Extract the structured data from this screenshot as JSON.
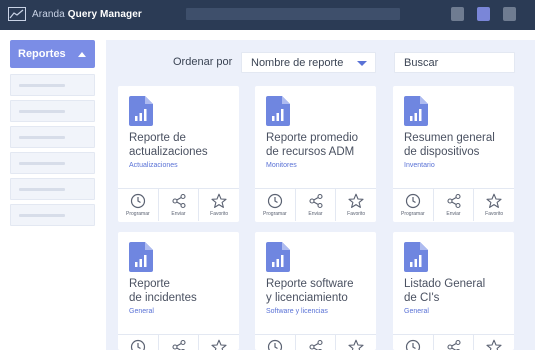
{
  "app": {
    "brand_prefix": "Aranda",
    "brand_name": "Query Manager"
  },
  "sidebar": {
    "header_label": "Reportes",
    "items_count_note": ""
  },
  "toolbar": {
    "sort_label": "Ordenar por",
    "sort_value": "Nombre de reporte",
    "search_placeholder": "Buscar"
  },
  "actions": {
    "schedule": "Programar",
    "send": "Enviar",
    "favorite": "Favorito"
  },
  "cards": [
    {
      "title_line1": "Reporte de",
      "title_line2": "actualizaciones",
      "category": "Actualizaciones"
    },
    {
      "title_line1": "Reporte promedio",
      "title_line2": "de recursos ADM",
      "category": "Monitores"
    },
    {
      "title_line1": "Resumen general",
      "title_line2": "de dispositivos",
      "category": "Inventario"
    },
    {
      "title_line1": "Reporte",
      "title_line2": "de incidentes",
      "category": "General"
    },
    {
      "title_line1": "Reporte software",
      "title_line2": "y licenciamiento",
      "category": "Software y licencias"
    },
    {
      "title_line1": "Listado General",
      "title_line2": "de CI's",
      "category": "General"
    }
  ],
  "colors": {
    "topbar": "#2b3b55",
    "accent": "#7b8de6",
    "link": "#5a72d6",
    "main_bg": "#ecf0fa"
  },
  "icons": [
    "chart-logo-icon",
    "document-chart-icon",
    "clock-icon",
    "share-icon",
    "star-icon",
    "caret-up-icon",
    "caret-down-icon"
  ]
}
